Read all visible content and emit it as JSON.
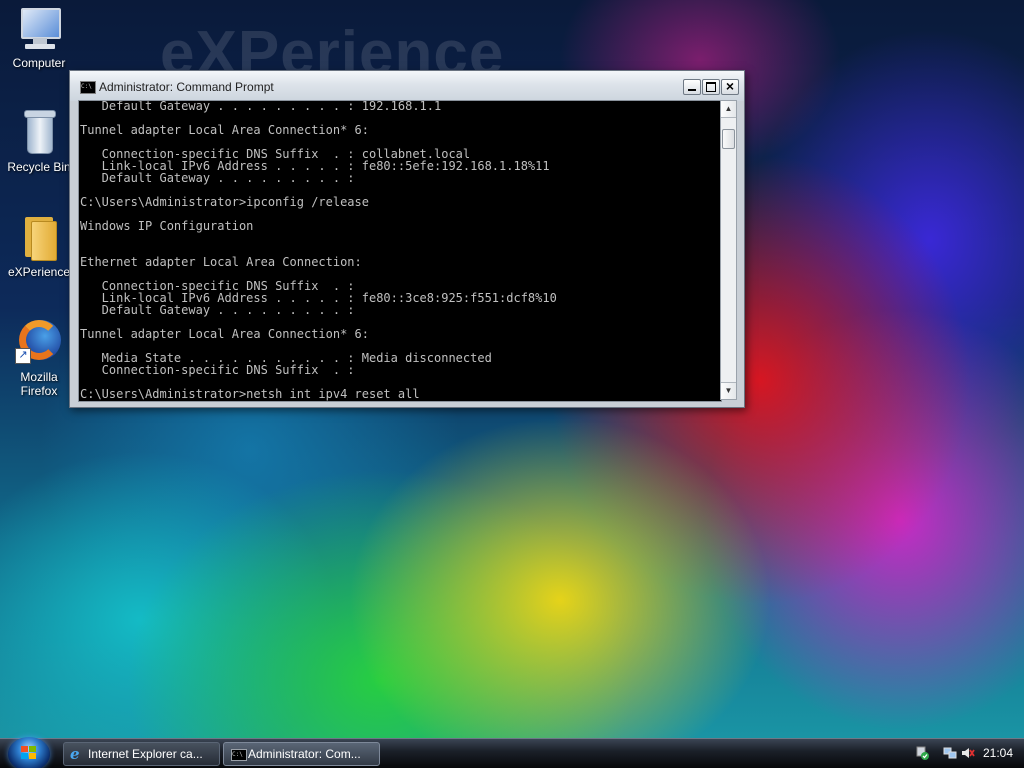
{
  "desktop": {
    "watermark": "eXPerience",
    "icons": [
      {
        "label": "Computer",
        "icon": "computer-icon"
      },
      {
        "label": "Recycle Bin",
        "icon": "recycle-bin-icon"
      },
      {
        "label": "eXPerience",
        "icon": "folder-icon"
      },
      {
        "label_line1": "Mozilla",
        "label_line2": "Firefox",
        "icon": "firefox-icon"
      }
    ]
  },
  "window": {
    "title": "Administrator: Command Prompt",
    "icon": "command-prompt-icon",
    "buttons": {
      "minimize": "minimize",
      "maximize": "maximize",
      "close": "×"
    },
    "console_lines": [
      "   Default Gateway . . . . . . . . . : 192.168.1.1",
      "",
      "Tunnel adapter Local Area Connection* 6:",
      "",
      "   Connection-specific DNS Suffix  . : collabnet.local",
      "   Link-local IPv6 Address . . . . . : fe80::5efe:192.168.1.18%11",
      "   Default Gateway . . . . . . . . . :",
      "",
      "C:\\Users\\Administrator>ipconfig /release",
      "",
      "Windows IP Configuration",
      "",
      "",
      "Ethernet adapter Local Area Connection:",
      "",
      "   Connection-specific DNS Suffix  . :",
      "   Link-local IPv6 Address . . . . . : fe80::3ce8:925:f551:dcf8%10",
      "   Default Gateway . . . . . . . . . :",
      "",
      "Tunnel adapter Local Area Connection* 6:",
      "",
      "   Media State . . . . . . . . . . . : Media disconnected",
      "   Connection-specific DNS Suffix  . :",
      "",
      "C:\\Users\\Administrator>netsh int ipv4 reset all"
    ]
  },
  "taskbar": {
    "start_icon": "windows-start-orb",
    "buttons": [
      {
        "label": "Internet Explorer ca...",
        "icon": "internet-explorer-icon"
      },
      {
        "label": "Administrator: Com...",
        "icon": "command-prompt-icon"
      }
    ],
    "tray_icons": [
      "windows-security-icon",
      "network-icon",
      "volume-muted-icon"
    ],
    "clock": "21:04"
  }
}
